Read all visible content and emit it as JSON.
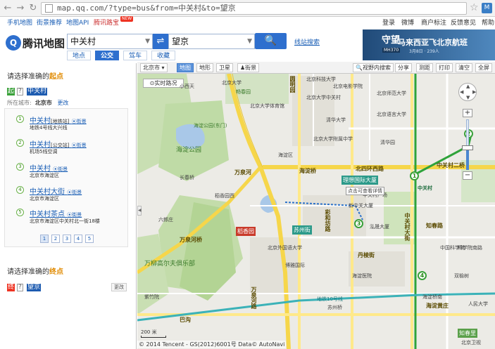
{
  "browser": {
    "url": "map.qq.com/?type=bus&from=中关村&to=望京",
    "back_icon": "back-arrow-icon",
    "forward_icon": "forward-arrow-icon",
    "reload_icon": "reload-icon"
  },
  "top_links": {
    "left": [
      "手机地图",
      "街景推荐",
      "地图API",
      "腾讯路宝"
    ],
    "new_badge": "NEW",
    "right": [
      "登录",
      "微博",
      "商户标注",
      "反馈意见",
      "帮助"
    ]
  },
  "header": {
    "logo_text": "腾讯地图",
    "from_value": "中关村",
    "to_value": "望京",
    "swap_symbol": "⇌",
    "line_search": "线站搜索",
    "modes": [
      "地点",
      "公交",
      "驾车",
      "收藏"
    ],
    "active_mode": "公交"
  },
  "ad": {
    "big": "守望",
    "sub": "MH370",
    "title": "马来西亚飞北京航班",
    "meta": "3月8日 · 239人"
  },
  "start_panel": {
    "title_prefix": "请选择准确的",
    "title_em": "起点",
    "tag_start": "起",
    "tag_q": "?",
    "keyword": "中关村",
    "city_label": "所在城市:",
    "city": "北京市",
    "change": "更改",
    "view_label": "街景",
    "results": [
      {
        "num": "1",
        "name": "中关村",
        "type": "[地铁站]",
        "desc": "地铁4号线大兴线"
      },
      {
        "num": "2",
        "name": "中关村",
        "type": "[公交站]",
        "desc": "机场5线空调"
      },
      {
        "num": "3",
        "name": "中关村",
        "type": "",
        "desc": "北京市海淀区"
      },
      {
        "num": "4",
        "name": "中关村大街",
        "type": "",
        "desc": "北京市海淀区"
      },
      {
        "num": "5",
        "name": "中关村茶点",
        "type": "",
        "desc": "北京市海淀区中关村北一街18楼"
      }
    ],
    "pages": [
      "1",
      "2",
      "3",
      "4",
      "5"
    ]
  },
  "end_panel": {
    "title_prefix": "请选择准确的",
    "title_em": "终点",
    "tag_end": "终",
    "tag_q": "?",
    "keyword": "望京",
    "change": "更改"
  },
  "map_toolbar": {
    "city": "北京市",
    "views": [
      "地图",
      "地形",
      "卫星",
      "街景"
    ],
    "active_view": "地图",
    "tools": [
      "视野内搜索",
      "分享",
      "测距",
      "打印",
      "清空",
      "全屏"
    ]
  },
  "map": {
    "realtime_traffic": "实时路况",
    "labels": [
      "小西天",
      "北京大学",
      "北京科技大学",
      "北京大学中关村",
      "北京电影学院",
      "北京师范大学",
      "畅春园",
      "圆明园",
      "北京大学体育馆",
      "清华大学",
      "北京语言大学",
      "清华园",
      "海淀公园",
      "海淀公园(东门)",
      "万泉河",
      "海淀区",
      "海淀桥",
      "北四环西路",
      "理想国际大厦",
      "中关村",
      "中关村二桥",
      "六郎庄",
      "稻香园",
      "苏州街",
      "知春里",
      "科学院南路",
      "海淀桥南",
      "双榆树",
      "稻香园西",
      "长春桥",
      "万柳高尔夫俱乐部",
      "巴沟",
      "万泉河路",
      "苏州桥",
      "中关村大街",
      "彩和坊路",
      "丹棱街",
      "海淀医院",
      "北京外国语大学",
      "紫竹院",
      "知春路",
      "中国科学院",
      "新中关大厦",
      "中关村广场",
      "海淀黄庄",
      "地铁10号线",
      "人民大学",
      "北京卫视",
      "北京大学附属中学",
      "博雅国际",
      "泓晟大厦",
      "万泉河桥"
    ],
    "marker_nums": [
      "1",
      "2",
      "3",
      "4"
    ],
    "popup": "点击可查看详情",
    "scale": "200 米",
    "copyright": "© 2014 Tencent - GS(2012)6001号 Data© AutoNavi",
    "zoom_pan_n": "▲",
    "zoom_pan_s": "▼",
    "zoom_pan_w": "◀",
    "zoom_pan_e": "▶",
    "zoom_level": 0.45
  }
}
